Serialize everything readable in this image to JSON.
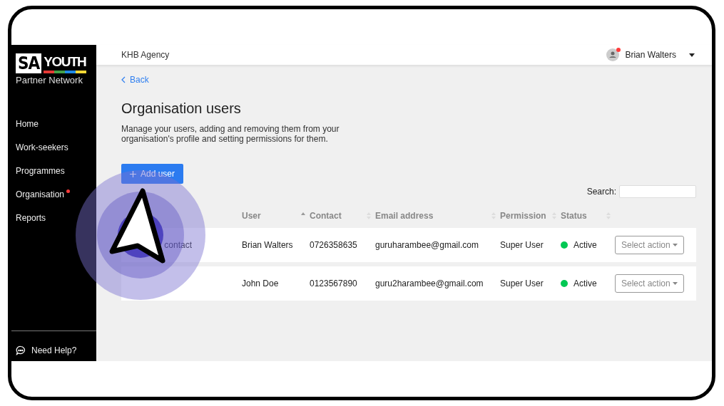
{
  "sidebar": {
    "logo": {
      "mark": "SA",
      "word": "YOUTH",
      "tagline": "Partner Network"
    },
    "items": [
      {
        "label": "Home",
        "dot": false
      },
      {
        "label": "Work-seekers",
        "dot": false
      },
      {
        "label": "Programmes",
        "dot": false
      },
      {
        "label": "Organisation",
        "dot": true
      },
      {
        "label": "Reports",
        "dot": false
      }
    ],
    "help": "Need Help?"
  },
  "header": {
    "agency": "KHB Agency",
    "user": {
      "name": "Brian Walters",
      "notification": true
    }
  },
  "page": {
    "back": "Back",
    "title": "Organisation users",
    "description": "Manage your users, adding and removing them from your organisation's profile and setting permissions for them.",
    "add_button": "Add user",
    "search": {
      "label": "Search:"
    }
  },
  "table": {
    "columns": [
      {
        "label": "User",
        "sorted": true
      },
      {
        "label": "Contact",
        "sorted": false
      },
      {
        "label": "Email address",
        "sorted": false
      },
      {
        "label": "Permission",
        "sorted": false
      },
      {
        "label": "Status",
        "sorted": false
      }
    ],
    "rows": [
      {
        "column_1": "contact",
        "user": "Brian Walters",
        "contact": "0726358635",
        "email": "guruharambee@gmail.com",
        "permission": "Super User",
        "status": "Active",
        "color": "#00c853",
        "action": "Select action"
      },
      {
        "user": "John Doe",
        "contact": "0123567890",
        "email": "guru2harambee@gmail.com",
        "permission": "Super User",
        "status": "Active",
        "color": "#00c853",
        "action": "Select action"
      }
    ]
  }
}
